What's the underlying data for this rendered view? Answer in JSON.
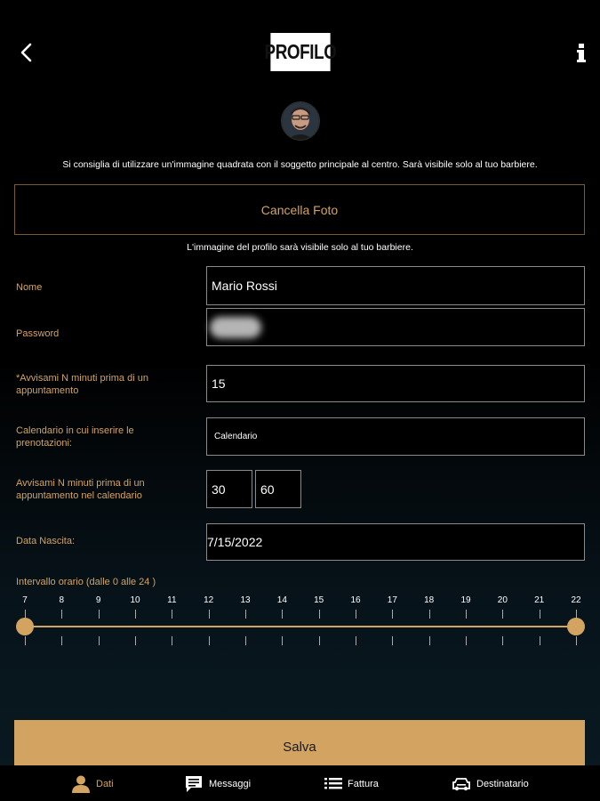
{
  "header": {
    "title": "PROFILO"
  },
  "photo": {
    "hint": "Si consiglia di utilizzare un'immagine quadrata con il soggetto principale al centro. Sarà visibile solo al tuo barbiere.",
    "delete_label": "Cancella Foto",
    "visibility_note": "L'immagine del profilo sarà visibile solo al tuo barbiere."
  },
  "form": {
    "name_label": "Nome",
    "name_value": "Mario Rossi",
    "password_label": "Password",
    "notify_label": "*Avvisami N minuti prima di un appuntamento",
    "notify_value": "15",
    "calendar_label": "Calendario in cui inserire le prenotazioni:",
    "calendar_value": "Calendario",
    "calendar_notify_label": "Avvisami N minuti prima di un appuntamento nel calendario",
    "calendar_notify_value_1": "30",
    "calendar_notify_value_2": "60",
    "birth_label": "Data Nascita:",
    "birth_value": "7/15/2022"
  },
  "slider": {
    "title": "Intervallo orario (dalle  0  alle  24 )",
    "ticks": [
      "7",
      "8",
      "9",
      "10",
      "11",
      "12",
      "13",
      "14",
      "15",
      "16",
      "17",
      "18",
      "19",
      "20",
      "21",
      "22"
    ],
    "min_value": 7,
    "max_value": 22
  },
  "save_label": "Salva",
  "tabs": [
    {
      "label": "Dati",
      "icon": "user-icon",
      "active": true
    },
    {
      "label": "Messaggi",
      "icon": "message-icon",
      "active": false
    },
    {
      "label": "Fattura",
      "icon": "list-icon",
      "active": false
    },
    {
      "label": "Destinatario",
      "icon": "car-icon",
      "active": false
    }
  ],
  "colors": {
    "accent": "#d3a461",
    "background": "#000000"
  }
}
